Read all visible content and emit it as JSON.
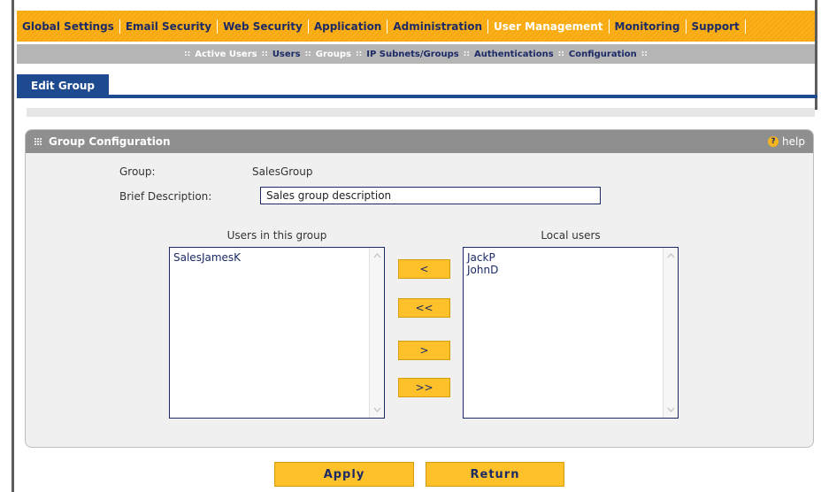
{
  "nav": {
    "main": [
      {
        "label": "Global Settings",
        "active": false
      },
      {
        "label": "Email Security",
        "active": false
      },
      {
        "label": "Web Security",
        "active": false
      },
      {
        "label": "Application",
        "active": false
      },
      {
        "label": "Administration",
        "active": false
      },
      {
        "label": "User Management",
        "active": true
      },
      {
        "label": "Monitoring",
        "active": false
      },
      {
        "label": "Support",
        "active": false
      }
    ],
    "sub": [
      {
        "label": "Active Users",
        "muted": true
      },
      {
        "label": "Users",
        "muted": false
      },
      {
        "label": "Groups",
        "muted": true
      },
      {
        "label": "IP Subnets/Groups",
        "muted": false
      },
      {
        "label": "Authentications",
        "muted": false
      },
      {
        "label": "Configuration",
        "muted": false
      }
    ],
    "sub_separator": "::"
  },
  "tab": {
    "label": "Edit Group"
  },
  "panel": {
    "title": "Group Configuration",
    "help_label": "help",
    "help_icon": "question-circle-icon",
    "group_label": "Group:",
    "group_value": "SalesGroup",
    "description_label": "Brief Description:",
    "description_value": "Sales group description"
  },
  "lists": {
    "members_title": "Users in this group",
    "members": [
      "SalesJamesK"
    ],
    "local_title": "Local users",
    "local": [
      "JackP",
      "JohnD"
    ]
  },
  "move_buttons": {
    "add": "<",
    "add_all": "<<",
    "remove": ">",
    "remove_all": ">>"
  },
  "actions": {
    "apply": "Apply",
    "return": "Return"
  },
  "colors": {
    "nav_orange": "#fbb21a",
    "nav_text": "#1c2a66",
    "tab_blue": "#1e4a8f",
    "panel_header": "#8f8f8f",
    "button_yellow": "#ffc12a"
  }
}
